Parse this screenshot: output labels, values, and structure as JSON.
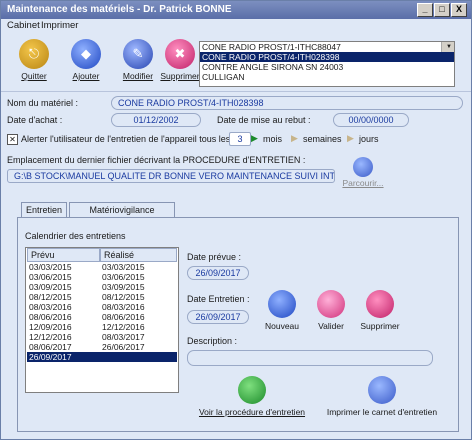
{
  "window": {
    "title": "Maintenance des matériels - Dr. Patrick BONNE",
    "controls": [
      "_",
      "□",
      "X"
    ]
  },
  "menu": [
    "Cabinet",
    "Imprimer"
  ],
  "toolbar": {
    "quit": "Quitter",
    "add": "Ajouter",
    "modify": "Modifier",
    "delete": "Supprimer"
  },
  "equipment_list": {
    "items": [
      "CONE RADIO PROST/1-ITHC88047",
      "CONE RADIO PROST/4-ITH028398",
      "CONTRE ANGLE SIRONA SN 24003",
      "CULLIGAN"
    ],
    "selected_index": 1
  },
  "form": {
    "name_label": "Nom du matériel :",
    "name_value": "CONE RADIO PROST/4-ITH028398",
    "purchase_label": "Date d'achat :",
    "purchase_value": "01/12/2002",
    "discard_label": "Date de mise au rebut :",
    "discard_value": "00/00/0000",
    "alert_text": "Alerter l'utilisateur de l'entretien de l'appareil tous les",
    "alert_value": "3",
    "unit_months": "mois",
    "unit_weeks": "semaines",
    "unit_days": "jours",
    "location_label": "Emplacement du dernier fichier décrivant la PROCEDURE d'ENTRETIEN :",
    "location_value": "G:\\B STOCK\\MANUEL QUALITE DR BONNE VERO MAINTENANCE SUIVI INTERVE",
    "browse_label": "Parcourir..."
  },
  "tabs": [
    "Entretien",
    "Matériovigilance"
  ],
  "maintenance": {
    "calendar_label": "Calendrier des entretiens",
    "col_planned": "Prévu",
    "col_done": "Réalisé",
    "rows": [
      [
        "03/03/2015",
        "03/03/2015"
      ],
      [
        "03/06/2015",
        "03/06/2015"
      ],
      [
        "03/09/2015",
        "03/09/2015"
      ],
      [
        "08/12/2015",
        "08/12/2015"
      ],
      [
        "08/03/2016",
        "08/03/2016"
      ],
      [
        "08/06/2016",
        "08/06/2016"
      ],
      [
        "12/09/2016",
        "12/12/2016"
      ],
      [
        "12/12/2016",
        "08/03/2017"
      ],
      [
        "08/06/2017",
        "26/06/2017"
      ],
      [
        "26/09/2017",
        ""
      ]
    ],
    "selected_row": 9,
    "planned_label": "Date prévue :",
    "planned_value": "26/09/2017",
    "done_label": "Date Entretien :",
    "done_value": "26/09/2017",
    "description_label": "Description :",
    "description_value": "",
    "btn_new": "Nouveau",
    "btn_validate": "Valider",
    "btn_delete": "Supprimer",
    "btn_view": "Voir la procédure d'entretien",
    "btn_print": "Imprimer le carnet d'entretien"
  },
  "colors": {
    "accent": "#0a246a",
    "field_text": "#1a3aa0",
    "background": "#dfe8f6"
  }
}
